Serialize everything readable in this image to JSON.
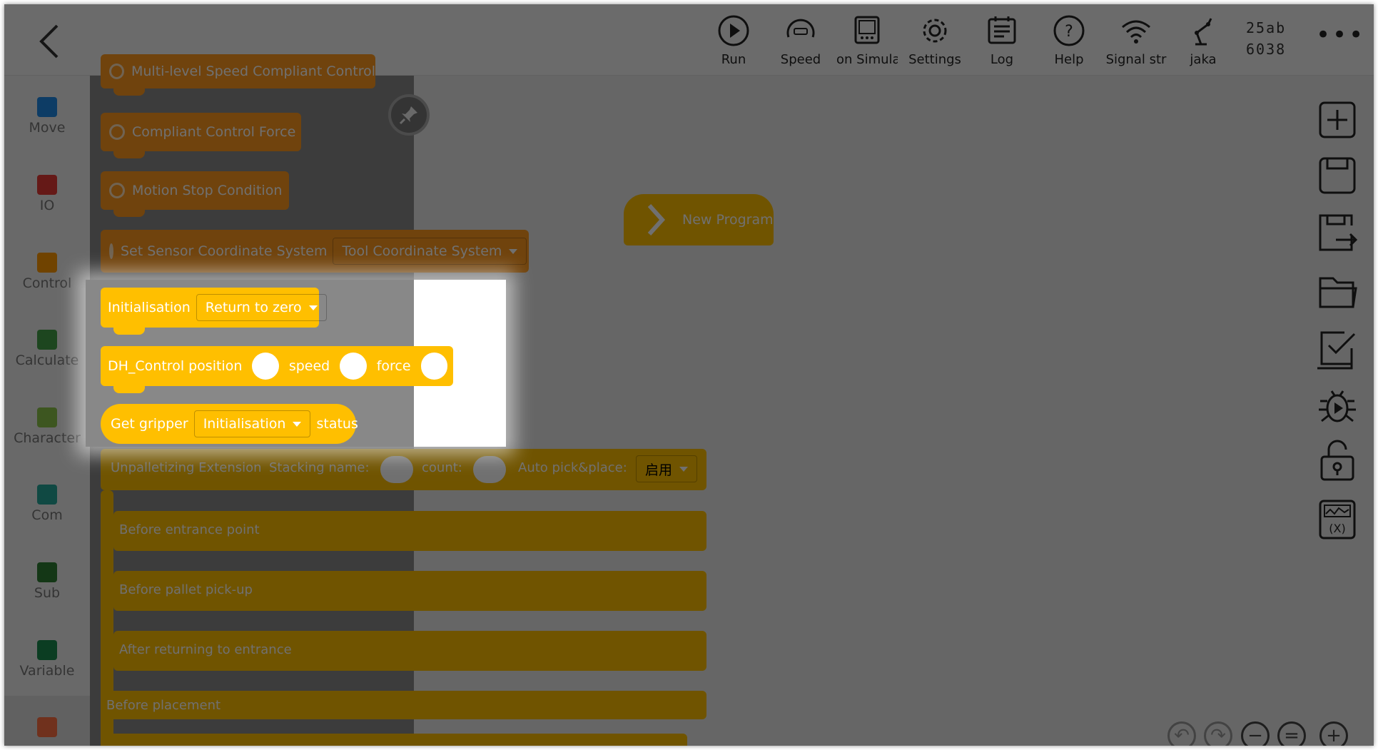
{
  "topbar": {
    "back_label": "back",
    "tools": [
      {
        "label": "Run",
        "icon": "play-circle-icon"
      },
      {
        "label": "Speed",
        "icon": "speedometer-icon"
      },
      {
        "label": "on Simulation",
        "icon": "simulation-icon"
      },
      {
        "label": "Settings",
        "icon": "gear-icon"
      },
      {
        "label": "Log",
        "icon": "log-icon"
      },
      {
        "label": "Help",
        "icon": "help-icon"
      },
      {
        "label": "Signal str",
        "icon": "wifi-icon"
      },
      {
        "label": "jaka",
        "icon": "robot-arm-icon"
      }
    ],
    "robot_id_line1": "25ab",
    "robot_id_line2": "6038",
    "more_label": "•••"
  },
  "categories": [
    {
      "label": "Move",
      "color": "#1e88e5"
    },
    {
      "label": "IO",
      "color": "#e53935"
    },
    {
      "label": "Control",
      "color": "#ff9800"
    },
    {
      "label": "Calculate",
      "color": "#43a047"
    },
    {
      "label": "Character",
      "color": "#8bc34a"
    },
    {
      "label": "Com",
      "color": "#26a69a"
    },
    {
      "label": "Sub",
      "color": "#2e7d32"
    },
    {
      "label": "Variable",
      "color": "#1b8c4e"
    },
    {
      "label": "",
      "color": "#ff7043"
    }
  ],
  "flyout": {
    "top_block": "Multi-level Speed Compliant Control",
    "compliant_force": "Compliant Control Force",
    "motion_stop": "Motion Stop Condition",
    "sensor_coord": "Set Sensor Coordinate System",
    "sensor_coord_value": "Tool Coordinate System",
    "initialisation_label": "Initialisation",
    "initialisation_value": "Return to zero",
    "dh_label": "DH_Control",
    "position_label": "position",
    "speed_label": "speed",
    "force_label": "force",
    "get_gripper_label": "Get gripper",
    "get_gripper_value": "Initialisation",
    "status_label": "status",
    "unpalletizing": "Unpalletizing Extension",
    "stacking_name": "Stacking name:",
    "count_label": "count:",
    "auto_pick": "Auto pick&place:",
    "auto_pick_value": "启用",
    "before_entrance": "Before entrance point",
    "before_pallet": "Before pallet pick-up",
    "after_returning": "After returning to entrance",
    "before_placement": "Before placement"
  },
  "workspace": {
    "new_program": "New Program"
  },
  "right_tools": [
    "add-icon",
    "save-icon",
    "save-as-icon",
    "open-folder-icon",
    "checklist-icon",
    "debug-icon",
    "lock-icon",
    "variable-monitor-icon"
  ],
  "zoom_controls": [
    "undo-icon",
    "redo-icon",
    "zoom-out-icon",
    "zoom-reset-icon",
    "zoom-in-icon"
  ]
}
